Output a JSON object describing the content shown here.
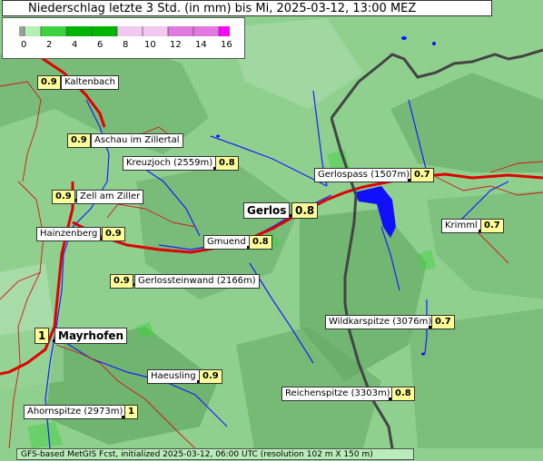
{
  "title": "Niederschlag letzte 3 Std. (in mm) bis Mi, 2025-03-12, 13:00 MEZ",
  "legend": {
    "ticks": [
      "0",
      "2",
      "4",
      "6",
      "8",
      "10",
      "12",
      "14",
      "16"
    ],
    "colors": [
      "#9e9e9e",
      "#b4f0b4",
      "#3ed23e",
      "#00b400",
      "#f0c8f0",
      "#e07ae0",
      "#ff00ff"
    ]
  },
  "places": [
    {
      "id": "kaltenbach",
      "name": "Kaltenbach",
      "value": "0.9"
    },
    {
      "id": "aschau",
      "name": "Aschau im Zillertal",
      "value": "0.9"
    },
    {
      "id": "kreuzjoch",
      "name": "Kreuzjoch (2559m)",
      "value": "0.8"
    },
    {
      "id": "zell",
      "name": "Zell am Ziller",
      "value": "0.9"
    },
    {
      "id": "gerlospass",
      "name": "Gerlospass (1507m)",
      "value": "0.7"
    },
    {
      "id": "gerlos",
      "name": "Gerlos",
      "value": "0.8"
    },
    {
      "id": "krimml",
      "name": "Krimml",
      "value": "0.7"
    },
    {
      "id": "hainzenberg",
      "name": "Hainzenberg",
      "value": "0.9"
    },
    {
      "id": "gmuend",
      "name": "Gmuend",
      "value": "0.8"
    },
    {
      "id": "gerlossteinwand",
      "name": "Gerlossteinwand (2166m)",
      "value": "0.9"
    },
    {
      "id": "wildkarspitze",
      "name": "Wildkarspitze (3076m)",
      "value": "0.7"
    },
    {
      "id": "mayrhofen",
      "name": "Mayrhofen",
      "value": "1"
    },
    {
      "id": "haeusling",
      "name": "Haeusling",
      "value": "0.9"
    },
    {
      "id": "reichenspitze",
      "name": "Reichenspitze (3303m)",
      "value": "0.8"
    },
    {
      "id": "ahornspitze",
      "name": "Ahornspitze (2973m)",
      "value": "1"
    }
  ],
  "footer": "GFS-based MetGIS Fcst, initialized 2025-03-12, 06:00 UTC  (resolution 102 m X 150 m)"
}
